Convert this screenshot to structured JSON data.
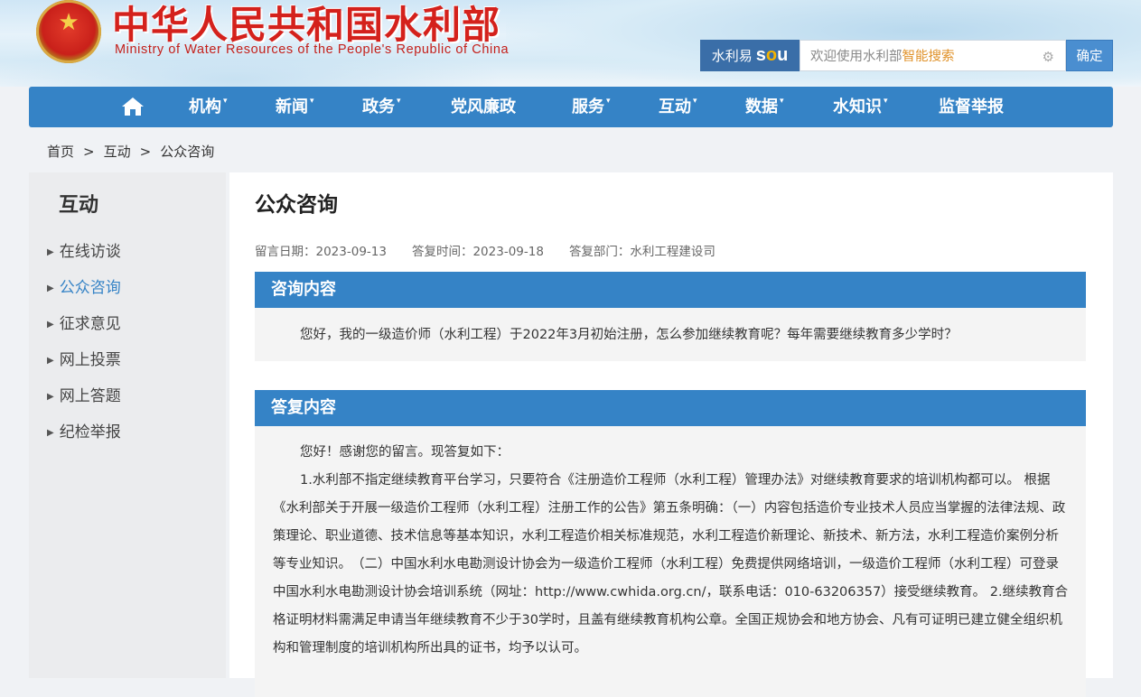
{
  "header": {
    "title": "中华人民共和国水利部",
    "subtitle": "Ministry of Water Resources of the People's Republic of China"
  },
  "search": {
    "brand_cn": "水利易",
    "brand_so_a": "s",
    "brand_so_b": "o",
    "brand_so_c": "u",
    "placeholder_a": "欢迎使用水利部",
    "placeholder_b": "智能搜索",
    "button": "确定"
  },
  "nav": {
    "items": [
      {
        "label": "机构",
        "dropdown": true
      },
      {
        "label": "新闻",
        "dropdown": true
      },
      {
        "label": "政务",
        "dropdown": true
      },
      {
        "label": "党风廉政",
        "dropdown": false
      },
      {
        "label": "服务",
        "dropdown": true
      },
      {
        "label": "互动",
        "dropdown": true
      },
      {
        "label": "数据",
        "dropdown": true
      },
      {
        "label": "水知识",
        "dropdown": true
      },
      {
        "label": "监督举报",
        "dropdown": false
      }
    ],
    "dropdown_glyph": "▾"
  },
  "breadcrumb": {
    "items": [
      "首页",
      "互动",
      "公众咨询"
    ],
    "separator": ">"
  },
  "sidebar": {
    "title": "互动",
    "items": [
      {
        "label": "在线访谈"
      },
      {
        "label": "公众咨询"
      },
      {
        "label": "征求意见"
      },
      {
        "label": "网上投票"
      },
      {
        "label": "网上答题"
      },
      {
        "label": "纪检举报"
      }
    ],
    "active_index": 1
  },
  "article": {
    "title": "公众咨询",
    "meta": {
      "post_date": "留言日期：2023-09-13",
      "reply_date": "答复时间：2023-09-18",
      "reply_dept": "答复部门：水利工程建设司"
    },
    "question": {
      "heading": "咨询内容",
      "text": "您好，我的一级造价师（水利工程）于2022年3月初始注册，怎么参加继续教育呢？每年需要继续教育多少学时？"
    },
    "answer": {
      "heading": "答复内容",
      "greeting": "您好！感谢您的留言。现答复如下：",
      "body": "1.水利部不指定继续教育平台学习，只要符合《注册造价工程师（水利工程）管理办法》对继续教育要求的培训机构都可以。 根据《水利部关于开展一级造价工程师（水利工程）注册工作的公告》第五条明确：（一）内容包括造价专业技术人员应当掌握的法律法规、政策理论、职业道德、技术信息等基本知识，水利工程造价相关标准规范，水利工程造价新理论、新技术、新方法，水利工程造价案例分析等专业知识。　（二）中国水利水电勘测设计协会为一级造价工程师（水利工程）免费提供网络培训，一级造价工程师（水利工程）可登录中国水利水电勘测设计协会培训系统（网址：http://www.cwhida.org.cn/，联系电话：010-63206357）接受继续教育。 2.继续教育合格证明材料需满足申请当年继续教育不少于30学时，且盖有继续教育机构公章。全国正规协会和地方协会、凡有可证明已建立健全组织机构和管理制度的培训机构所出具的证书，均予以认可。"
    }
  },
  "colors": {
    "nav_blue": "#3583c6",
    "title_red": "#d4211c",
    "search_brand": "#3a6ea8",
    "highlight_orange": "#e0922a"
  },
  "icons": {
    "home": "home-icon",
    "gear": "gear-icon",
    "emblem": "national-emblem-icon",
    "bullet": "triangle-right-icon"
  }
}
